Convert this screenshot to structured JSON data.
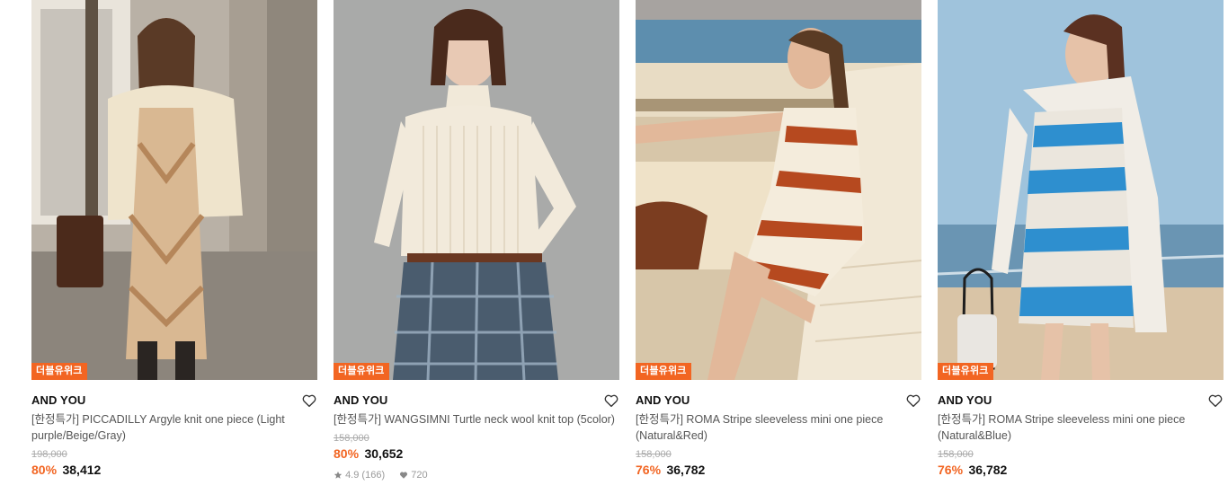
{
  "colors": {
    "accent": "#f26522",
    "text": "#111111",
    "muted": "#999999"
  },
  "products": [
    {
      "badge": "더블유위크",
      "brand": "AND YOU",
      "title": "[한정특가] PICCADILLY Argyle knit one piece (Light purple/Beige/Gray)",
      "original_price": "198,000",
      "discount": "80%",
      "price": "38,412"
    },
    {
      "badge": "더블유위크",
      "brand": "AND YOU",
      "title": "[한정특가] WANGSIMNI Turtle neck wool knit top (5color)",
      "original_price": "158,000",
      "discount": "80%",
      "price": "30,652",
      "rating": "4.9",
      "review_count": "(166)",
      "likes": "720"
    },
    {
      "badge": "더블유위크",
      "brand": "AND YOU",
      "title": "[한정특가] ROMA Stripe sleeveless mini one piece (Natural&Red)",
      "original_price": "158,000",
      "discount": "76%",
      "price": "36,782"
    },
    {
      "badge": "더블유위크",
      "brand": "AND YOU",
      "title": "[한정특가] ROMA Stripe sleeveless mini one piece (Natural&Blue)",
      "original_price": "158,000",
      "discount": "76%",
      "price": "36,782"
    }
  ],
  "icons": {
    "wishlist": "heart-outline-icon",
    "rating": "star-icon",
    "likes": "heart-filled-icon"
  }
}
